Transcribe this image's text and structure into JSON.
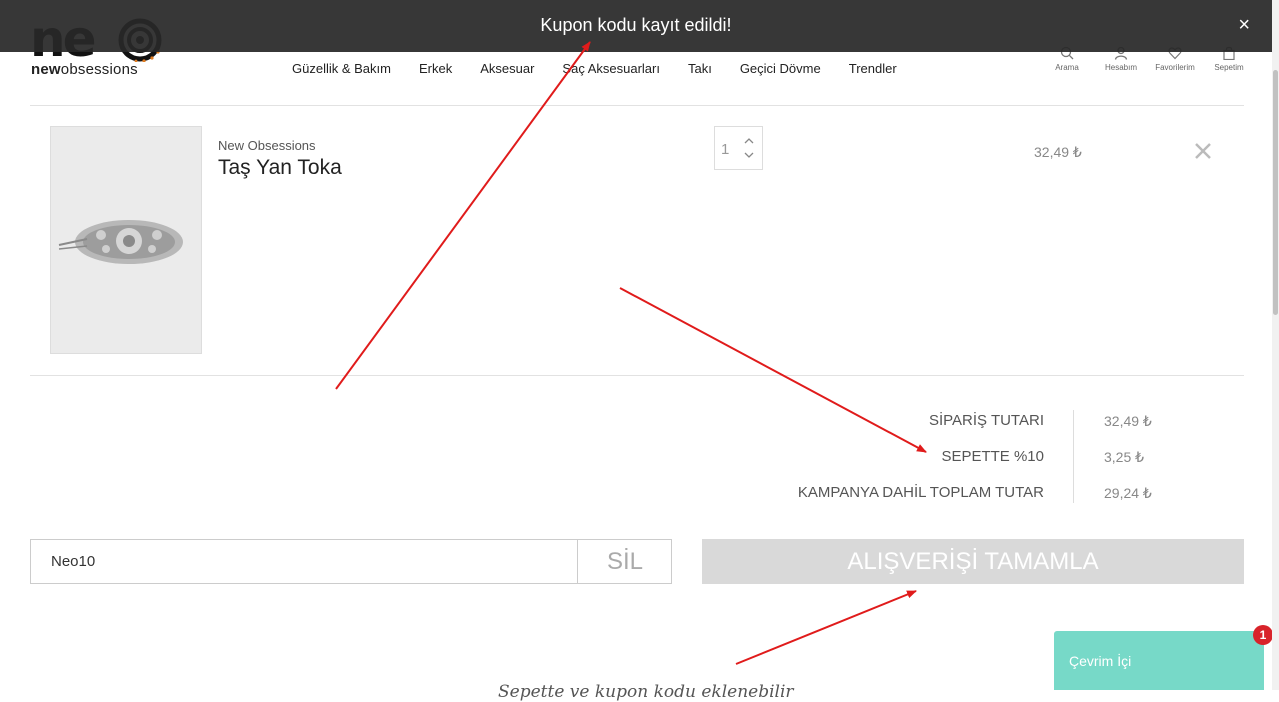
{
  "toast": {
    "message": "Kupon kodu kayıt edildi!",
    "close": "×"
  },
  "logo": {
    "word": "ne",
    "subtitle_bold": "new",
    "subtitle_rest": "obsessions"
  },
  "nav": [
    "Güzellik & Bakım",
    "Erkek",
    "Aksesuar",
    "Saç Aksesuarları",
    "Takı",
    "Geçici Dövme",
    "Trendler"
  ],
  "header_icons": [
    {
      "label": "Arama",
      "icon": "search-icon"
    },
    {
      "label": "Hesabım",
      "icon": "user-icon"
    },
    {
      "label": "Favorilerim",
      "icon": "heart-icon"
    },
    {
      "label": "Sepetim",
      "icon": "bag-icon"
    }
  ],
  "cart_item": {
    "brand": "New Obsessions",
    "name": "Taş Yan Toka",
    "quantity": "1",
    "price": "32,49 ₺"
  },
  "summary": [
    {
      "label": "SİPARİŞ TUTARI",
      "value": "32,49 ₺"
    },
    {
      "label": "SEPETTE %10",
      "value": "3,25 ₺"
    },
    {
      "label": "KAMPANYA DAHİL TOPLAM TUTAR",
      "value": "29,24 ₺"
    }
  ],
  "coupon": {
    "value": "Neo10",
    "button": "SİL"
  },
  "checkout": "ALIŞVERİŞİ TAMAMLA",
  "chat": {
    "label": "Çevrim İçi",
    "badge": "1"
  },
  "bottom_text": "Sepette ve kupon kodu eklenebilir",
  "colors": {
    "annotation_arrow": "#e01b1b",
    "chat": "#77d9c8",
    "badge": "#d8232a",
    "toast": "#282828",
    "checkout": "#d9d9d9"
  }
}
